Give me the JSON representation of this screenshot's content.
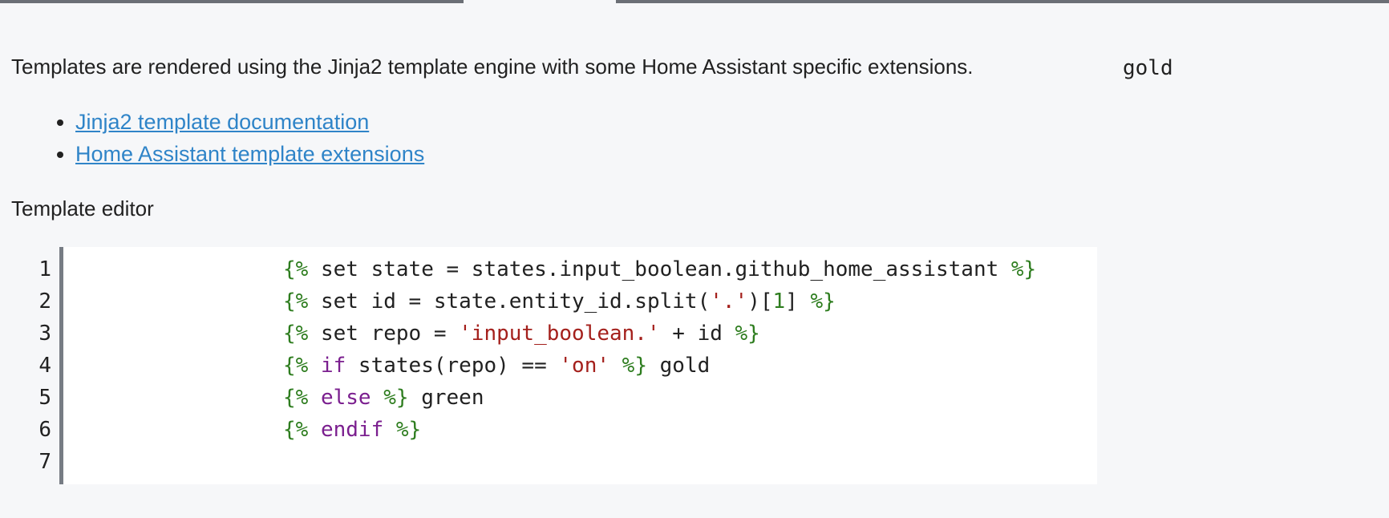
{
  "tabs": {
    "active_index": 1
  },
  "intro": {
    "text": "Templates are rendered using the Jinja2 template engine with some Home Assistant specific extensions."
  },
  "result": {
    "output": "gold"
  },
  "links": [
    {
      "label": "Jinja2 template documentation"
    },
    {
      "label": "Home Assistant template extensions"
    }
  ],
  "editor": {
    "label": "Template editor",
    "line_numbers": [
      "1",
      "2",
      "3",
      "4",
      "5",
      "6",
      "7"
    ],
    "lines": [
      [
        {
          "t": "{%",
          "c": "brace"
        },
        {
          "t": " set state = states.input_boolean.github_home_assistant ",
          "c": "plain"
        },
        {
          "t": "%}",
          "c": "brace"
        }
      ],
      [
        {
          "t": "{%",
          "c": "brace"
        },
        {
          "t": " set id = state.entity_id.split(",
          "c": "plain"
        },
        {
          "t": "'.'",
          "c": "str"
        },
        {
          "t": ")[",
          "c": "plain"
        },
        {
          "t": "1",
          "c": "num"
        },
        {
          "t": "] ",
          "c": "plain"
        },
        {
          "t": "%}",
          "c": "brace"
        }
      ],
      [
        {
          "t": "{%",
          "c": "brace"
        },
        {
          "t": " set repo = ",
          "c": "plain"
        },
        {
          "t": "'input_boolean.'",
          "c": "str"
        },
        {
          "t": " + id ",
          "c": "plain"
        },
        {
          "t": "%}",
          "c": "brace"
        }
      ],
      [
        {
          "t": "{%",
          "c": "brace"
        },
        {
          "t": " ",
          "c": "plain"
        },
        {
          "t": "if",
          "c": "kw"
        },
        {
          "t": " states(repo) == ",
          "c": "plain"
        },
        {
          "t": "'on'",
          "c": "str"
        },
        {
          "t": " ",
          "c": "plain"
        },
        {
          "t": "%}",
          "c": "brace"
        },
        {
          "t": " gold",
          "c": "plain"
        }
      ],
      [
        {
          "t": "{%",
          "c": "brace"
        },
        {
          "t": " ",
          "c": "plain"
        },
        {
          "t": "else",
          "c": "kw"
        },
        {
          "t": " ",
          "c": "plain"
        },
        {
          "t": "%}",
          "c": "brace"
        },
        {
          "t": " green",
          "c": "plain"
        }
      ],
      [
        {
          "t": "{%",
          "c": "brace"
        },
        {
          "t": " ",
          "c": "plain"
        },
        {
          "t": "endif",
          "c": "kw"
        },
        {
          "t": " ",
          "c": "plain"
        },
        {
          "t": "%}",
          "c": "brace"
        }
      ],
      []
    ]
  },
  "colors": {
    "link": "#2f84c8",
    "brace": "#2e7d1f",
    "keyword": "#7b1f8f",
    "string": "#a4201c",
    "gutter_border": "#777c84",
    "background": "#f6f7f9"
  }
}
